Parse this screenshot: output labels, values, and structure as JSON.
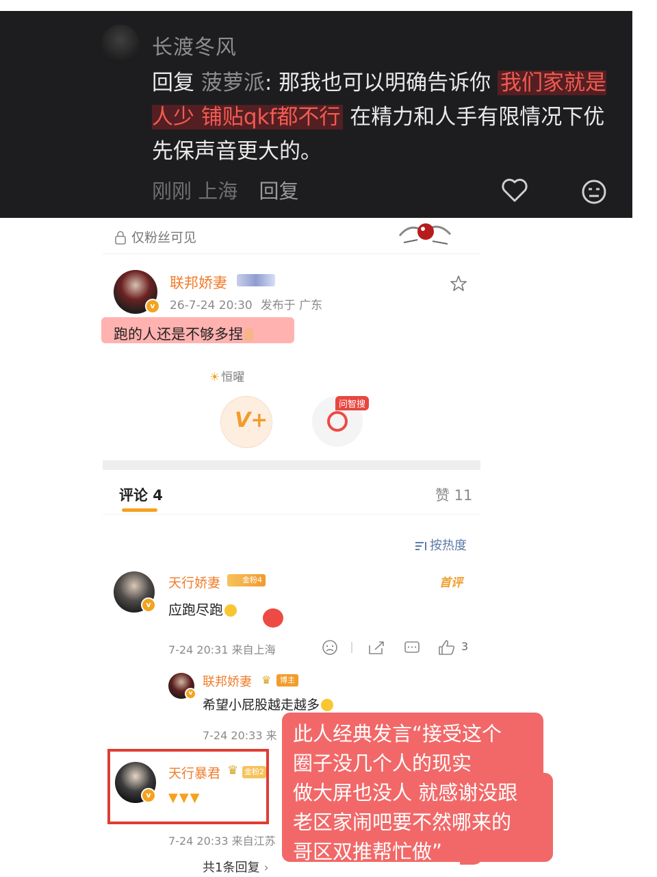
{
  "dark_reply": {
    "username": "长渡冬风",
    "text_prefix": "回复 ",
    "mention": "菠萝派",
    "text_colon": ": 那我也可以明确告诉你 ",
    "highlight": "我们家就是人少 铺贴qkf都不行",
    "text_rest": " 在精力和人手有限情况下优先保声音更大的。",
    "time": "刚刚",
    "location": "上海",
    "reply_label": "回复"
  },
  "post": {
    "visibility": "仅粉丝可见",
    "author": "联邦娇妻",
    "date": "26-7-24 20:30",
    "location": "发布于 广东",
    "text": "跑的人还是不够多捏",
    "topic": "恒曜",
    "ask_badge": "问智搜"
  },
  "tabs": {
    "comments": "评论 4",
    "likes": "赞 11",
    "sort": "按热度"
  },
  "comments": [
    {
      "name": "天行娇妻",
      "badge": "金粉4",
      "first_tag": "首评",
      "text": "应跑尽跑",
      "meta": "7-24 20:31  来自上海",
      "likes": "3"
    },
    {
      "name": "天行暴君",
      "badge": "金粉2",
      "meta": "7-24 20:33  来自江苏",
      "replies": "共1条回复"
    }
  ],
  "reply": {
    "name": "联邦娇妻",
    "badge": "博主",
    "text": "希望小屁股越走越多",
    "meta": "7-24 20:33  来"
  },
  "annotation": {
    "lines": [
      "此人经典发言“接受这个",
      "圈子没几个人的现实",
      "做大屏也没人 就感谢没跟",
      "老区家闹吧要不然哪来的",
      "哥区双推帮忙做”"
    ]
  },
  "colors": {
    "accent_orange": "#f07c2a",
    "highlight_red": "#f25b50",
    "annotation_red": "#f26868",
    "box_red": "#df3d33"
  },
  "icons": [
    "heart-icon",
    "neutral-face-icon",
    "lock-icon",
    "star-icon",
    "sun-icon",
    "sort-icon",
    "sad-face-icon",
    "share-icon",
    "comment-icon",
    "thumbs-up-icon"
  ]
}
